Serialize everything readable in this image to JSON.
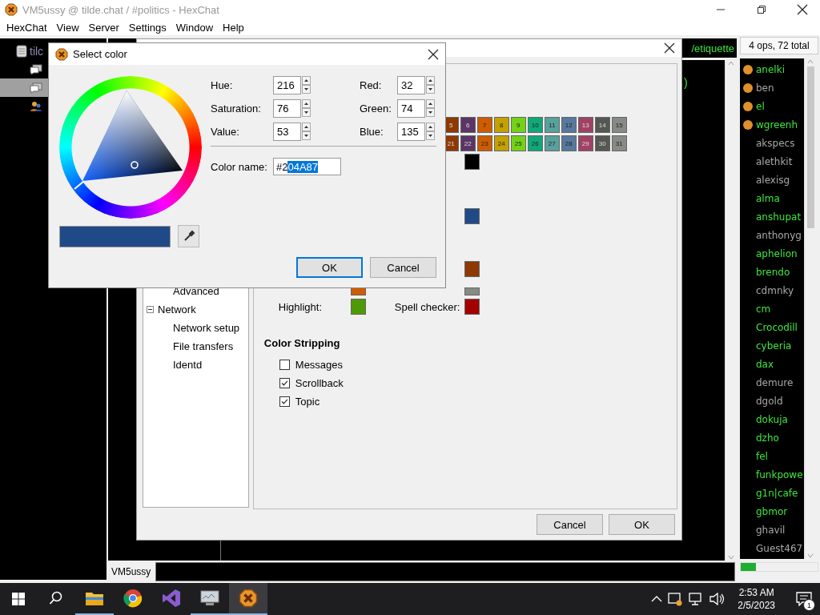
{
  "window": {
    "title": "VM5ussy @ tilde.chat / #politics - HexChat"
  },
  "menu": [
    "HexChat",
    "View",
    "Server",
    "Settings",
    "Window",
    "Help"
  ],
  "server_tree": [
    {
      "kind": "server",
      "label": "tilc",
      "selected": false
    },
    {
      "kind": "channel",
      "selected": false
    },
    {
      "kind": "channel",
      "selected": true
    },
    {
      "kind": "users",
      "selected": false
    }
  ],
  "topic": "/etiquette",
  "chat_fragment": ")",
  "user_count": "4 ops, 72 total",
  "users": [
    {
      "nick": "anelki",
      "op": true,
      "away": false
    },
    {
      "nick": "ben",
      "op": true,
      "away": true
    },
    {
      "nick": "el",
      "op": true,
      "away": false
    },
    {
      "nick": "wgreenh",
      "op": true,
      "away": false
    },
    {
      "nick": "akspecs",
      "op": false,
      "away": true
    },
    {
      "nick": "alethkit",
      "op": false,
      "away": true
    },
    {
      "nick": "alexisg",
      "op": false,
      "away": true
    },
    {
      "nick": "alma",
      "op": false,
      "away": false
    },
    {
      "nick": "anshupat",
      "op": false,
      "away": false
    },
    {
      "nick": "anthonyg",
      "op": false,
      "away": true
    },
    {
      "nick": "aphelion",
      "op": false,
      "away": false
    },
    {
      "nick": "brendo",
      "op": false,
      "away": false
    },
    {
      "nick": "cdmnky",
      "op": false,
      "away": true
    },
    {
      "nick": "cm",
      "op": false,
      "away": false
    },
    {
      "nick": "Crocodill",
      "op": false,
      "away": false
    },
    {
      "nick": "cyberia",
      "op": false,
      "away": false
    },
    {
      "nick": "dax",
      "op": false,
      "away": false
    },
    {
      "nick": "demure",
      "op": false,
      "away": true
    },
    {
      "nick": "dgold",
      "op": false,
      "away": true
    },
    {
      "nick": "dokuja",
      "op": false,
      "away": false
    },
    {
      "nick": "dzho",
      "op": false,
      "away": false
    },
    {
      "nick": "fel",
      "op": false,
      "away": false
    },
    {
      "nick": "funkpowe",
      "op": false,
      "away": false
    },
    {
      "nick": "g1n|cafe",
      "op": false,
      "away": false
    },
    {
      "nick": "gbmor",
      "op": false,
      "away": false
    },
    {
      "nick": "ghavil",
      "op": false,
      "away": true
    },
    {
      "nick": "Guest467",
      "op": false,
      "away": true
    }
  ],
  "nick_button": "VM5ussy",
  "lag": {
    "level": 0.2
  },
  "preferences": {
    "tree": [
      {
        "children": [
          {
            "label": "Advanced"
          }
        ]
      },
      {
        "label": "Network",
        "expanded": true,
        "children": [
          {
            "label": "Network setup"
          },
          {
            "label": "File transfers"
          },
          {
            "label": "Identd"
          }
        ]
      }
    ],
    "palette": [
      [
        {
          "label": "5",
          "color": "#8f3902"
        },
        {
          "label": "6",
          "color": "#5c3566"
        },
        {
          "label": "7",
          "color": "#ce5c00"
        },
        {
          "label": "8",
          "color": "#c4a000"
        },
        {
          "label": "9",
          "color": "#73d216"
        },
        {
          "label": "10",
          "color": "#11a879"
        },
        {
          "label": "11",
          "color": "#58a19d"
        },
        {
          "label": "12",
          "color": "#57799e"
        },
        {
          "label": "13",
          "color": "#a04265"
        },
        {
          "label": "14",
          "color": "#555753"
        },
        {
          "label": "15",
          "color": "#888a85"
        }
      ],
      [
        {
          "label": "21",
          "color": "#8f3902"
        },
        {
          "label": "22",
          "color": "#5c3566"
        },
        {
          "label": "23",
          "color": "#ce5c00"
        },
        {
          "label": "24",
          "color": "#c4a000"
        },
        {
          "label": "25",
          "color": "#73d216"
        },
        {
          "label": "26",
          "color": "#11a879"
        },
        {
          "label": "27",
          "color": "#58a19d"
        },
        {
          "label": "28",
          "color": "#57799e"
        },
        {
          "label": "29",
          "color": "#a04265"
        },
        {
          "label": "30",
          "color": "#555753"
        },
        {
          "label": "31",
          "color": "#888a85"
        }
      ]
    ],
    "swatches": [
      {
        "color": "#000000"
      },
      {
        "color": "#204a87"
      },
      {
        "color": "#8f3902"
      }
    ],
    "color_rows": [
      {
        "left": {
          "color": "#ce5c00"
        },
        "right": {
          "color": "#888a85"
        }
      },
      {
        "left": {
          "label": "Highlight:",
          "color": "#4e9a06"
        },
        "right": {
          "label": "Spell checker:",
          "color": "#a40000"
        }
      }
    ],
    "stripping": {
      "title": "Color Stripping",
      "options": [
        {
          "label": "Messages",
          "checked": false
        },
        {
          "label": "Scrollback",
          "checked": true
        },
        {
          "label": "Topic",
          "checked": true
        }
      ]
    },
    "buttons": [
      {
        "label": "Cancel",
        "default": false
      },
      {
        "label": "OK",
        "default": false
      }
    ]
  },
  "color_dialog": {
    "title": "Select color",
    "fields": [
      {
        "label": "Hue:",
        "value": "216"
      },
      {
        "label": "Red:",
        "value": "32"
      },
      {
        "label": "Saturation:",
        "value": "76"
      },
      {
        "label": "Green:",
        "value": "74"
      },
      {
        "label": "Value:",
        "value": "53"
      },
      {
        "label": "Blue:",
        "value": "135"
      }
    ],
    "color_name": {
      "label": "Color name:",
      "text_before_selection": "#2",
      "selected_text": "04A87"
    },
    "buttons": [
      {
        "label": "OK",
        "default": true
      },
      {
        "label": "Cancel",
        "default": false
      }
    ]
  },
  "taskbar": {
    "apps": [
      {
        "kind": "search",
        "running": false,
        "active": false
      },
      {
        "kind": "folder",
        "running": true,
        "active": false
      },
      {
        "kind": "browser",
        "running": false,
        "active": false
      },
      {
        "kind": "editor",
        "running": false,
        "active": false
      },
      {
        "kind": "monitor",
        "running": true,
        "active": false
      },
      {
        "kind": "hexchat",
        "running": true,
        "active": true
      }
    ],
    "time": "2:53 AM",
    "date": "2/5/2023",
    "notifications": "1"
  }
}
